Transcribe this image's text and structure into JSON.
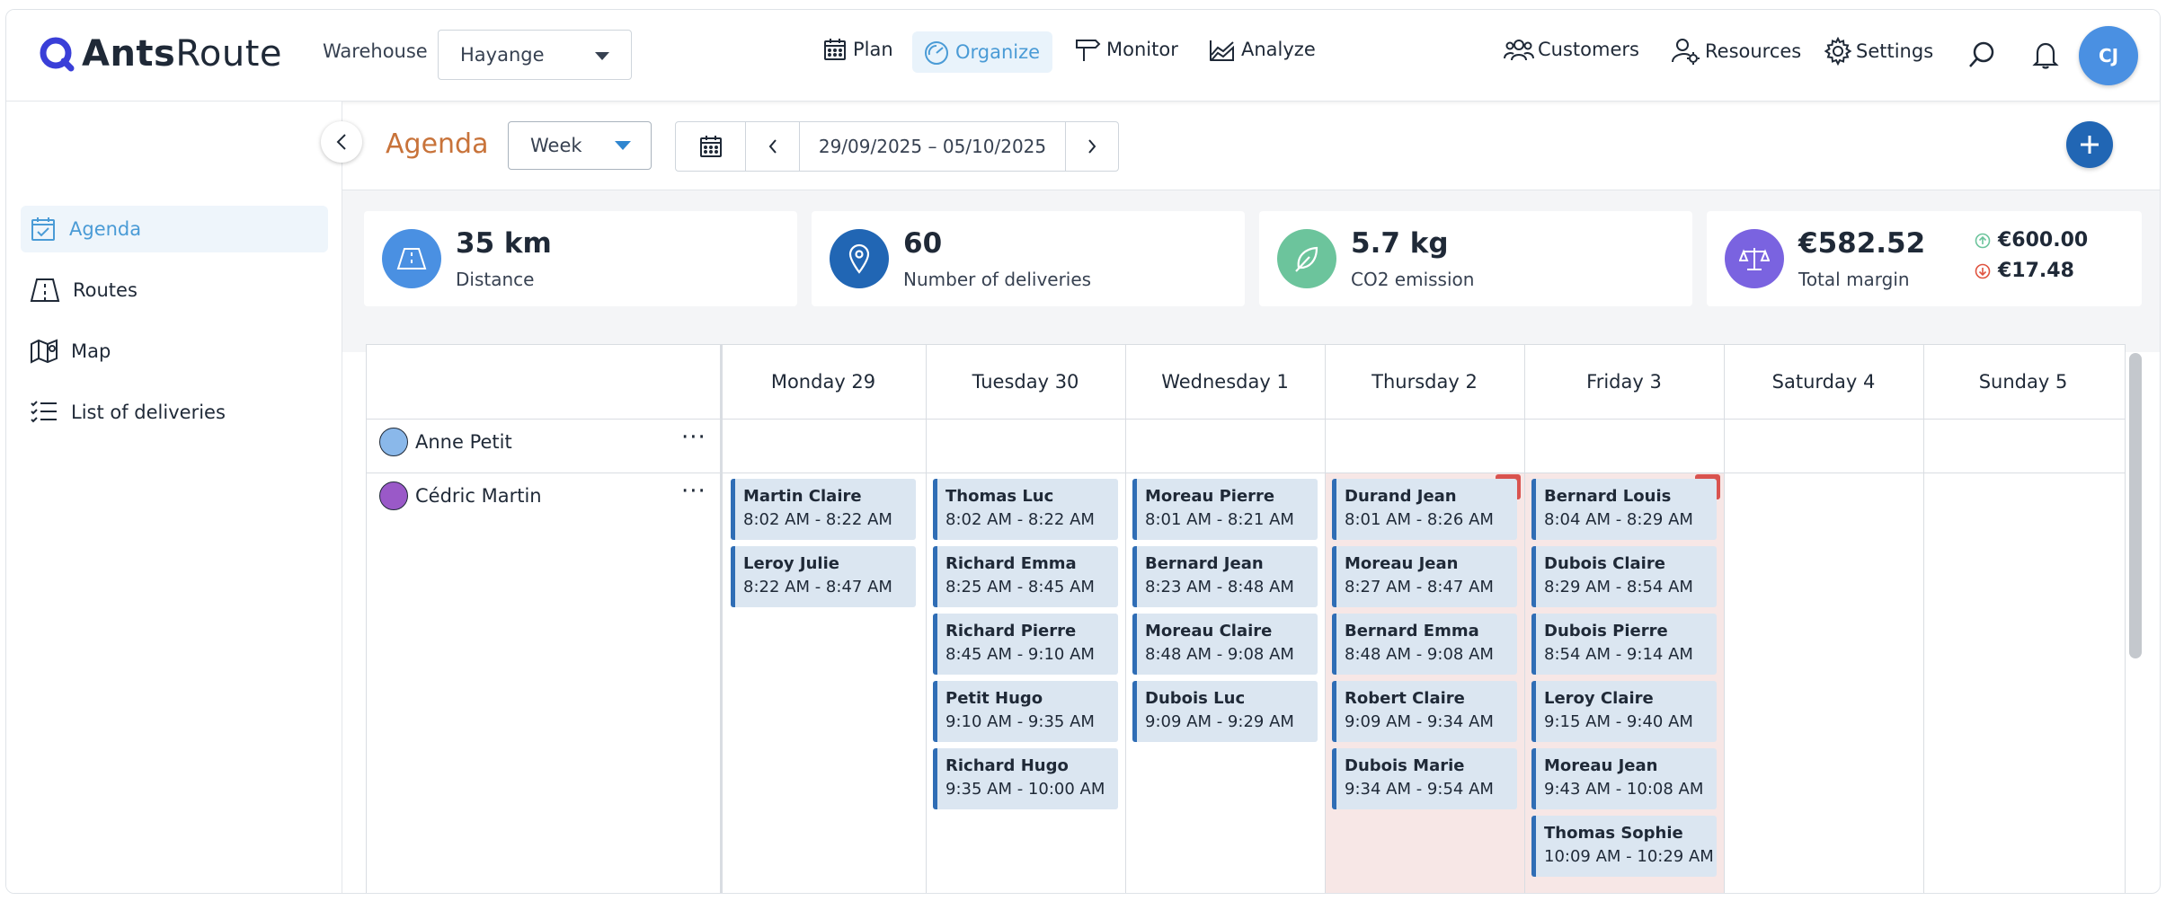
{
  "header": {
    "logo_bold": "Ants",
    "logo_light": "Route",
    "warehouse_label": "Warehouse",
    "warehouse_value": "Hayange",
    "nav": {
      "plan": "Plan",
      "organize": "Organize",
      "monitor": "Monitor",
      "analyze": "Analyze",
      "customers": "Customers",
      "resources": "Resources",
      "settings": "Settings"
    },
    "avatar_initials": "CJ",
    "accent_color": "#4a9bd6",
    "brand_color": "#2166b4"
  },
  "sidebar": {
    "items": [
      {
        "label": "Agenda",
        "icon": "calendar-check-icon",
        "active": true
      },
      {
        "label": "Routes",
        "icon": "road-map-icon",
        "active": false
      },
      {
        "label": "Map",
        "icon": "map-icon",
        "active": false
      },
      {
        "label": "List of deliveries",
        "icon": "checklist-icon",
        "active": false
      }
    ]
  },
  "toolbar": {
    "title": "Agenda",
    "view_mode": "Week",
    "date_range": "29/09/2025 – 05/10/2025"
  },
  "stats": {
    "distance": {
      "value": "35 km",
      "label": "Distance",
      "color": "#4a90e2"
    },
    "deliveries": {
      "value": "60",
      "label": "Number of deliveries",
      "color": "#2166b4"
    },
    "co2": {
      "value": "5.7 kg",
      "label": "CO2 emission",
      "color": "#6cc49c"
    },
    "margin": {
      "value": "€582.52",
      "label": "Total margin",
      "color": "#7a63e0",
      "up": "€600.00",
      "down": "€17.48"
    }
  },
  "calendar": {
    "days": [
      "Monday 29",
      "Tuesday 30",
      "Wednesday 1",
      "Thursday 2",
      "Friday 3",
      "Saturday 4",
      "Sunday 5"
    ],
    "resources": [
      {
        "name": "Anne Petit",
        "color": "#8ab8ea"
      },
      {
        "name": "Cédric Martin",
        "color": "#9a59c8"
      }
    ],
    "locked_days": [
      3,
      4
    ],
    "columns": [
      [
        {
          "name": "Martin Claire",
          "time": "8:02 AM - 8:22 AM"
        },
        {
          "name": "Leroy Julie",
          "time": "8:22 AM - 8:47 AM"
        }
      ],
      [
        {
          "name": "Thomas Luc",
          "time": "8:02 AM - 8:22 AM"
        },
        {
          "name": "Richard Emma",
          "time": "8:25 AM - 8:45 AM"
        },
        {
          "name": "Richard Pierre",
          "time": "8:45 AM - 9:10 AM"
        },
        {
          "name": "Petit Hugo",
          "time": "9:10 AM - 9:35 AM"
        },
        {
          "name": "Richard Hugo",
          "time": "9:35 AM - 10:00 AM"
        }
      ],
      [
        {
          "name": "Moreau Pierre",
          "time": "8:01 AM - 8:21 AM"
        },
        {
          "name": "Bernard Jean",
          "time": "8:23 AM - 8:48 AM"
        },
        {
          "name": "Moreau Claire",
          "time": "8:48 AM - 9:08 AM"
        },
        {
          "name": "Dubois Luc",
          "time": "9:09 AM - 9:29 AM"
        }
      ],
      [
        {
          "name": "Durand Jean",
          "time": "8:01 AM - 8:26 AM"
        },
        {
          "name": "Moreau Jean",
          "time": "8:27 AM - 8:47 AM"
        },
        {
          "name": "Bernard Emma",
          "time": "8:48 AM - 9:08 AM"
        },
        {
          "name": "Robert Claire",
          "time": "9:09 AM - 9:34 AM"
        },
        {
          "name": "Dubois Marie",
          "time": "9:34 AM - 9:54 AM"
        }
      ],
      [
        {
          "name": "Bernard Louis",
          "time": "8:04 AM - 8:29 AM"
        },
        {
          "name": "Dubois Claire",
          "time": "8:29 AM - 8:54 AM"
        },
        {
          "name": "Dubois Pierre",
          "time": "8:54 AM - 9:14 AM"
        },
        {
          "name": "Leroy Claire",
          "time": "9:15 AM - 9:40 AM"
        },
        {
          "name": "Moreau Jean",
          "time": "9:43 AM - 10:08 AM"
        },
        {
          "name": "Thomas Sophie",
          "time": "10:09 AM - 10:29 AM"
        }
      ],
      [],
      []
    ]
  }
}
